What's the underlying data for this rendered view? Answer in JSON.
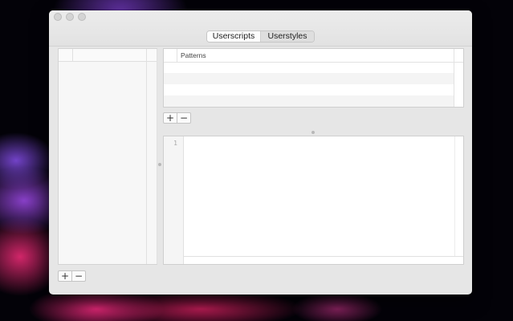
{
  "tabs": [
    {
      "label": "Userscripts",
      "selected": true
    },
    {
      "label": "Userstyles",
      "selected": false
    }
  ],
  "patterns_table": {
    "header": "Patterns",
    "rows": []
  },
  "patterns_buttons": {
    "add": "+",
    "remove": "−"
  },
  "sidebar_buttons": {
    "add": "+",
    "remove": "−"
  },
  "editor": {
    "line_numbers": [
      "1"
    ],
    "content": ""
  }
}
